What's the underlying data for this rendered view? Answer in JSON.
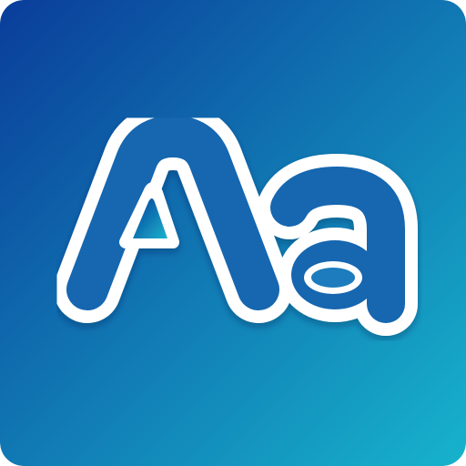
{
  "icon": {
    "glyph_text": "Aa",
    "icon_name": "font-letters-icon",
    "colors": {
      "gradient_start": "#0a3d9a",
      "gradient_end": "#17b3cc",
      "letter_outline": "#ffffff",
      "letter_fill": "#1566b0"
    }
  }
}
